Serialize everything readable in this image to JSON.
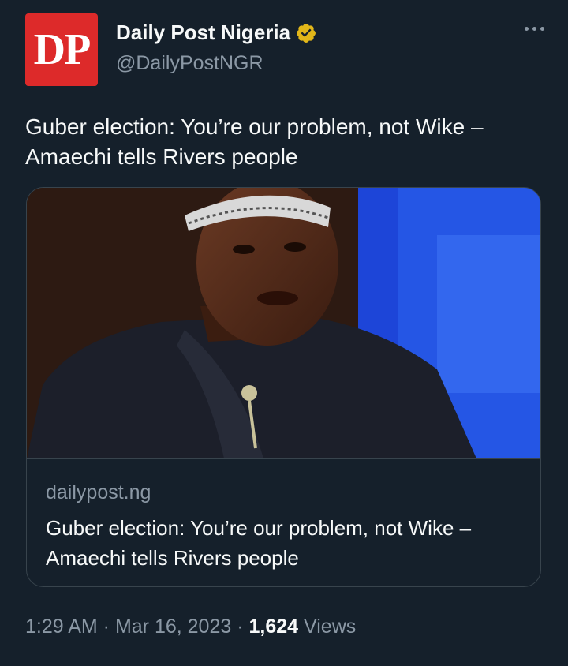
{
  "author": {
    "avatar_text": "DP",
    "display_name": "Daily Post Nigeria",
    "handle": "@DailyPostNGR",
    "verified_badge_icon": "gold-check-badge-icon"
  },
  "tweet": {
    "text": "Guber election: You’re our problem, not Wike – Amaechi tells Rivers people"
  },
  "card": {
    "domain": "dailypost.ng",
    "title": "Guber election: You’re our problem, not Wike – Amaechi tells Rivers people"
  },
  "meta": {
    "time": "1:29 AM",
    "separator": " · ",
    "date": "Mar 16, 2023",
    "views_count": "1,624",
    "views_label": " Views"
  },
  "colors": {
    "background": "#15202b",
    "text_primary": "#f7f9f9",
    "text_secondary": "#8b98a5",
    "avatar_red": "#dd2a2a",
    "badge_gold": "#e2b719"
  }
}
